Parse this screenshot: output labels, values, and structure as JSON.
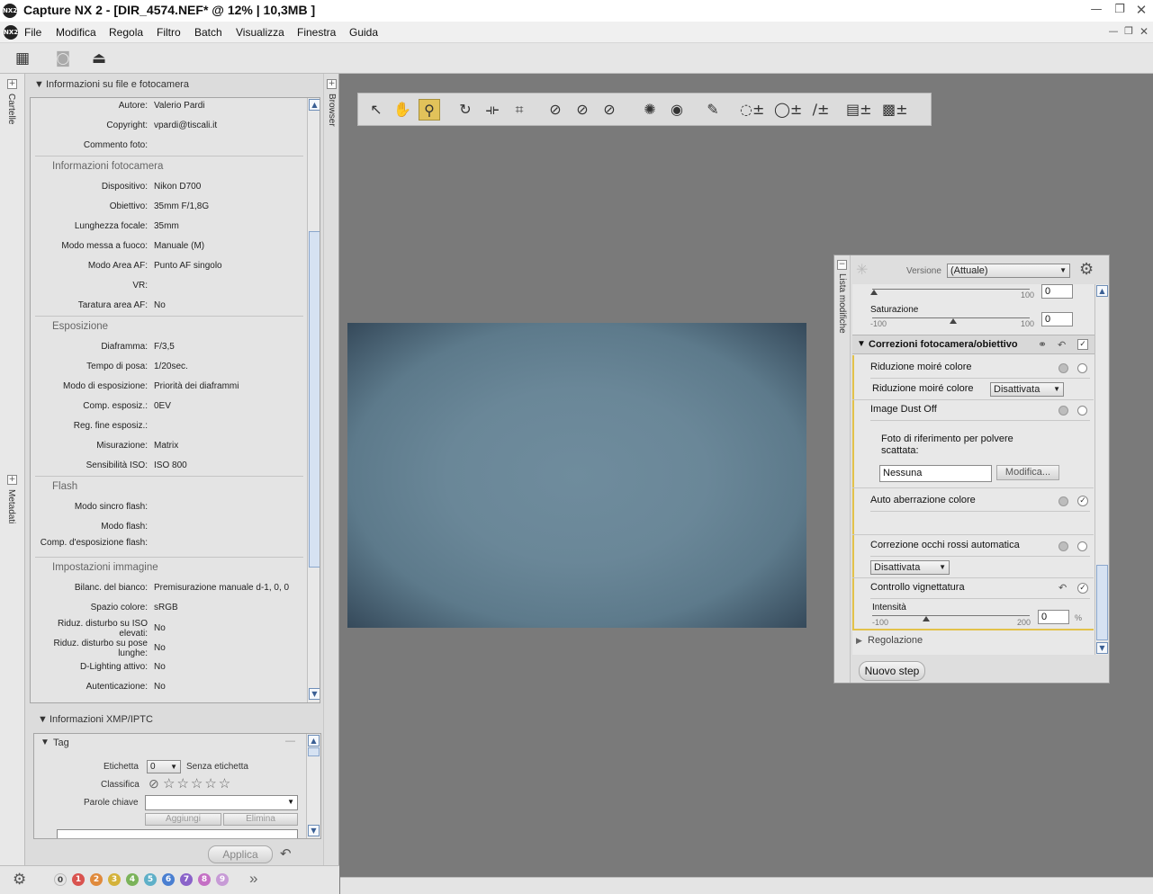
{
  "window": {
    "title": "Capture NX 2 - [DIR_4574.NEF* @ 12% | 10,3MB ]",
    "logo": "NX2"
  },
  "menu": [
    "File",
    "Modifica",
    "Regola",
    "Filtro",
    "Batch",
    "Visualizza",
    "Finestra",
    "Guida"
  ],
  "left_tabs": {
    "cartelle": "Cartelle",
    "metadati": "Metadati",
    "browser": "Browser"
  },
  "file_info": {
    "header": "Informazioni su file e fotocamera",
    "rows_top": [
      {
        "label": "Autore:",
        "value": "Valerio Pardi"
      },
      {
        "label": "Copyright:",
        "value": "vpardi@tiscali.it"
      },
      {
        "label": "Commento foto:",
        "value": ""
      }
    ],
    "camera_group": "Informazioni fotocamera",
    "camera_rows": [
      {
        "label": "Dispositivo:",
        "value": "Nikon D700"
      },
      {
        "label": "Obiettivo:",
        "value": "35mm F/1,8G"
      },
      {
        "label": "Lunghezza focale:",
        "value": "35mm"
      },
      {
        "label": "Modo messa a fuoco:",
        "value": "Manuale (M)"
      },
      {
        "label": "Modo Area AF:",
        "value": "Punto AF singolo"
      },
      {
        "label": "VR:",
        "value": ""
      },
      {
        "label": "Taratura area AF:",
        "value": "No"
      }
    ],
    "exposure_group": "Esposizione",
    "exposure_rows": [
      {
        "label": "Diaframma:",
        "value": "F/3,5"
      },
      {
        "label": "Tempo di posa:",
        "value": "1/20sec."
      },
      {
        "label": "Modo di esposizione:",
        "value": "Priorità dei diaframmi"
      },
      {
        "label": "Comp. esposiz.:",
        "value": "0EV"
      },
      {
        "label": "Reg. fine esposiz.:",
        "value": ""
      },
      {
        "label": "Misurazione:",
        "value": "Matrix"
      },
      {
        "label": "Sensibilità ISO:",
        "value": "ISO 800"
      }
    ],
    "flash_group": "Flash",
    "flash_rows": [
      {
        "label": "Modo sincro flash:",
        "value": ""
      },
      {
        "label": "Modo flash:",
        "value": ""
      },
      {
        "label": "Comp. d'esposizione flash:",
        "value": ""
      }
    ],
    "image_group": "Impostazioni immagine",
    "image_rows": [
      {
        "label": "Bilanc. del bianco:",
        "value": "Premisurazione manuale d-1, 0, 0"
      },
      {
        "label": "Spazio colore:",
        "value": "sRGB"
      },
      {
        "label": "Riduz. disturbo su ISO elevati:",
        "value": "No"
      },
      {
        "label": "Riduz. disturbo su pose lunghe:",
        "value": "No"
      },
      {
        "label": "D-Lighting attivo:",
        "value": "No"
      },
      {
        "label": "Autenticazione:",
        "value": "No"
      }
    ]
  },
  "xmp": {
    "header": "Informazioni XMP/IPTC",
    "tag_header": "Tag",
    "etichetta_label": "Etichetta",
    "etichetta_value": "0",
    "etichetta_text": "Senza etichetta",
    "classifica_label": "Classifica",
    "stars": "☆☆☆☆☆",
    "parole_label": "Parole chiave",
    "aggiungi": "Aggiungi",
    "elimina": "Elimina",
    "applica": "Applica"
  },
  "labels_bar": [
    "0",
    "1",
    "2",
    "3",
    "4",
    "5",
    "6",
    "7",
    "8",
    "9"
  ],
  "label_colors": [
    "#e6e6e6",
    "#d9534f",
    "#e08a3c",
    "#d4b23a",
    "#7bb35a",
    "#5fb0c8",
    "#4a7fd1",
    "#8a63c9",
    "#c46fc4",
    "#c79bd6"
  ],
  "edit_panel": {
    "tab": "Lista modifiche",
    "versione_label": "Versione",
    "versione_value": "(Attuale)",
    "top_value1": "0",
    "saturazione_label": "Saturazione",
    "saturazione_min": "-100",
    "saturazione_max": "100",
    "saturazione_value": "0",
    "slider_max_top": "100",
    "section_title": "Correzioni fotocamera/obiettivo",
    "moire_title": "Riduzione moiré colore",
    "moire_label": "Riduzione moiré colore",
    "moire_value": "Disattivata",
    "dust_title": "Image Dust Off",
    "dust_desc": "Foto di riferimento per polvere scattata:",
    "dust_value": "Nessuna",
    "dust_button": "Modifica...",
    "aberr_title": "Auto aberrazione colore",
    "redeye_title": "Correzione occhi rossi automatica",
    "redeye_value": "Disattivata",
    "vignette_title": "Controllo vignettatura",
    "intensita_label": "Intensità",
    "intensita_min": "-100",
    "intensita_max": "200",
    "intensita_value": "0",
    "percent": "%",
    "regolazione": "Regolazione",
    "nuovo_step": "Nuovo step"
  }
}
